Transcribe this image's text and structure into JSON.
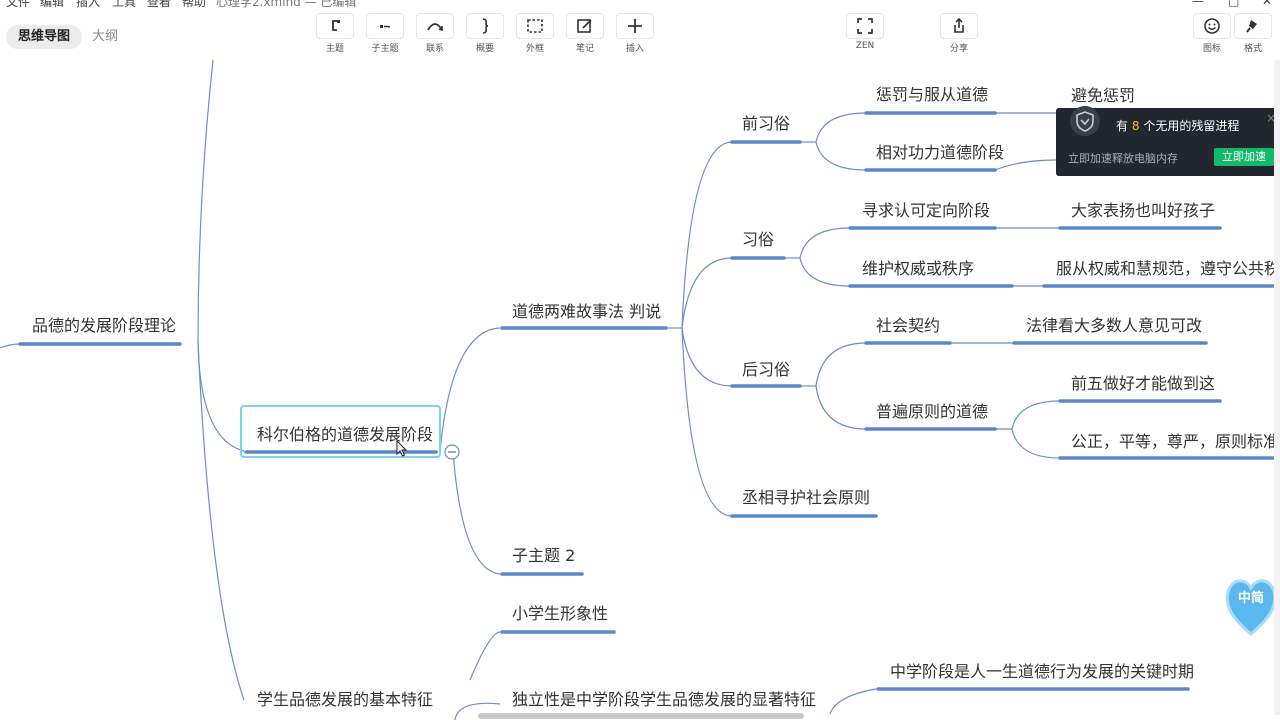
{
  "menubar": {
    "items": [
      "文件",
      "编辑",
      "插入",
      "工具",
      "查看",
      "帮助"
    ],
    "document_title": "心理学2.xmind — 已编辑"
  },
  "view_tabs": {
    "mindmap": "思维导图",
    "outline": "大纲"
  },
  "toolbar": {
    "topic": "主题",
    "subtopic": "子主题",
    "relation": "联系",
    "summary": "概要",
    "boundary": "外框",
    "note": "笔记",
    "insert": "插入",
    "zen": "ZEN",
    "share": "分享",
    "icons": "图标",
    "format": "格式"
  },
  "mindmap": {
    "pinde": "品德的发展阶段理论",
    "kohlberg": "科尔伯格的道德发展阶段",
    "dilemma": "道德两难故事法 判说",
    "preconv": "前习俗",
    "punish": "惩罚与服从道德",
    "avoid": "避免惩罚",
    "relative": "相对功力道德阶段",
    "conv": "习俗",
    "seek": "寻求认可定向阶段",
    "praise": "大家表扬也叫好孩子",
    "maintain": "维护权威或秩序",
    "obey": "服从权威和慧规范，遵守公共秩序",
    "postconv": "后习俗",
    "contract": "社会契约",
    "law": "法律看大多数人意见可改",
    "universal": "普遍原则的道德",
    "first5": "前五做好才能做到这",
    "justice": "公正，平等，尊严，原则标准进行",
    "mutual": "丞相寻护社会原则",
    "sub2": "子主题 2",
    "pupil": "小学生形象性",
    "features": "学生品德发展的基本特征",
    "independence": "独立性是中学阶段学生品德发展的显著特征",
    "middle": "中学阶段是人一生道德行为发展的关键时期"
  },
  "popup": {
    "prefix": "有",
    "count": "8",
    "suffix": "个无用的残留进程",
    "subtitle": "立即加速释放电脑内存",
    "button": "立即加速",
    "close": "×"
  },
  "widget": {
    "text": "中简"
  },
  "colors": {
    "line": "#6b8fc7",
    "underline": "#5b87c8",
    "selection": "#7fd3e6",
    "popup_bg": "#22262e",
    "popup_button": "#14b86a"
  }
}
